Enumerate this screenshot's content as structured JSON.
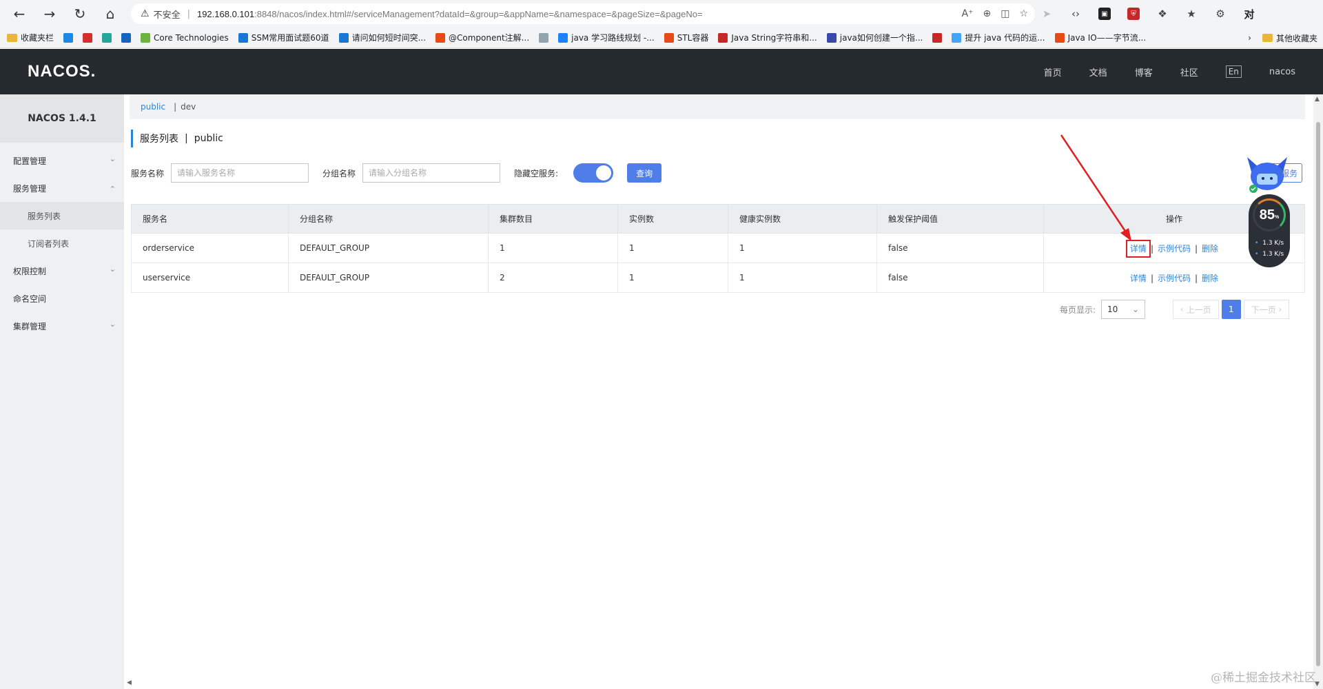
{
  "browser": {
    "insecure_label": "不安全",
    "url_host": "192.168.0.101",
    "url_rest": ":8848/nacos/index.html#/serviceManagement?dataId=&group=&appName=&namespace=&pageSize=&pageNo=",
    "profile_label": "对",
    "bookmarks": [
      {
        "label": "收藏夹栏",
        "icon": "folder-icon",
        "color": "#e8b63c"
      },
      {
        "label": "",
        "icon": "bilibili-icon",
        "color": "#1e88e5"
      },
      {
        "label": "",
        "icon": "red-icon",
        "color": "#d32f2f"
      },
      {
        "label": "",
        "icon": "circle-icon",
        "color": "#26a69a"
      },
      {
        "label": "",
        "icon": "on-icon",
        "color": "#1565c0"
      },
      {
        "label": "Core Technologies",
        "icon": "spring-icon",
        "color": "#6db33f"
      },
      {
        "label": "SSM常用面试题60道",
        "icon": "zhihu-icon",
        "color": "#1976d2"
      },
      {
        "label": "请问如何短时间突...",
        "icon": "zhihu-icon",
        "color": "#1976d2"
      },
      {
        "label": "@Component注解...",
        "icon": "csdn-icon",
        "color": "#e64a19"
      },
      {
        "label": "",
        "icon": "leaf-icon",
        "color": "#90a4ae"
      },
      {
        "label": "java 学习路线规划 -...",
        "icon": "juejin-icon",
        "color": "#1e80ff"
      },
      {
        "label": "STL容器",
        "icon": "csdn-icon",
        "color": "#e64a19"
      },
      {
        "label": "Java String字符串和...",
        "icon": "csdn-icon",
        "color": "#c62828"
      },
      {
        "label": "java如何创建一个指...",
        "icon": "baidu-icon",
        "color": "#3949ab"
      },
      {
        "label": "",
        "icon": "csdn-icon",
        "color": "#c62828"
      },
      {
        "label": "提升 java 代码的运...",
        "icon": "cloud-icon",
        "color": "#42a5f5"
      },
      {
        "label": "Java IO——字节流...",
        "icon": "csdn-icon",
        "color": "#e64a19"
      }
    ],
    "other_bookmarks": "其他收藏夹"
  },
  "header": {
    "logo": "NACOS.",
    "nav": [
      "首页",
      "文档",
      "博客",
      "社区"
    ],
    "lang": "En",
    "user": "nacos"
  },
  "sidebar": {
    "title": "NACOS 1.4.1",
    "items": [
      {
        "label": "配置管理",
        "expandable": true
      },
      {
        "label": "服务管理",
        "expandable": true,
        "expanded": true,
        "children": [
          "服务列表",
          "订阅者列表"
        ]
      },
      {
        "label": "权限控制",
        "expandable": true
      },
      {
        "label": "命名空间",
        "expandable": false
      },
      {
        "label": "集群管理",
        "expandable": true
      }
    ]
  },
  "breadcrumb": {
    "active": "public",
    "other": "dev"
  },
  "page": {
    "title": "服务列表",
    "namespace": "public"
  },
  "filters": {
    "service_name_label": "服务名称",
    "service_name_placeholder": "请输入服务名称",
    "group_name_label": "分组名称",
    "group_name_placeholder": "请输入分组名称",
    "hide_empty_label": "隐藏空服务:",
    "hide_empty_on": true,
    "query_label": "查询",
    "create_label": "服务"
  },
  "table": {
    "columns": [
      "服务名",
      "分组名称",
      "集群数目",
      "实例数",
      "健康实例数",
      "触发保护阈值",
      "操作"
    ],
    "rows": [
      {
        "name": "orderservice",
        "group": "DEFAULT_GROUP",
        "clusters": "1",
        "instances": "1",
        "healthy": "1",
        "threshold": "false"
      },
      {
        "name": "userservice",
        "group": "DEFAULT_GROUP",
        "clusters": "2",
        "instances": "1",
        "healthy": "1",
        "threshold": "false"
      }
    ],
    "actions": {
      "detail": "详情",
      "sample": "示例代码",
      "delete": "删除"
    }
  },
  "pagination": {
    "per_page_label": "每页显示:",
    "page_size": "10",
    "prev": "上一页",
    "current": "1",
    "next": "下一页"
  },
  "widget": {
    "percent": "85",
    "percent_unit": "%",
    "upload": "1.3 K/s",
    "download": "1.3 K/s"
  },
  "watermark": "@稀土掘金技术社区",
  "colors": {
    "accent": "#4f7ee8",
    "link": "#2a86db",
    "header_bg": "#252a2f",
    "annotation": "#e02020"
  }
}
